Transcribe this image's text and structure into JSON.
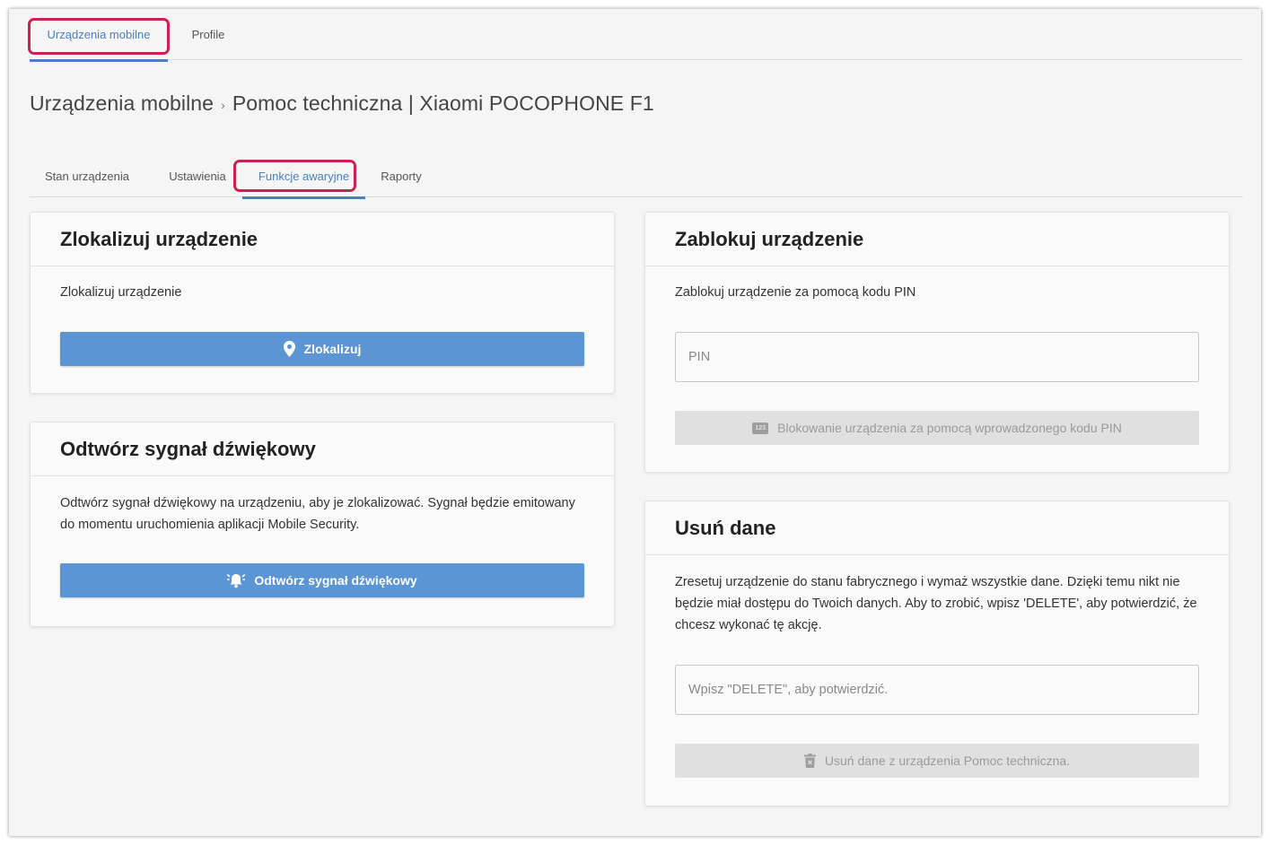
{
  "top_tabs": [
    {
      "label": "Urządzenia mobilne",
      "active": true
    },
    {
      "label": "Profile",
      "active": false
    }
  ],
  "breadcrumb": {
    "root": "Urządzenia mobilne",
    "separator": "›",
    "current": "Pomoc techniczna | Xiaomi POCOPHONE F1"
  },
  "sub_tabs": [
    {
      "label": "Stan urządzenia",
      "active": false
    },
    {
      "label": "Ustawienia",
      "active": false
    },
    {
      "label": "Funkcje awaryjne",
      "active": true
    },
    {
      "label": "Raporty",
      "active": false
    }
  ],
  "locate": {
    "title": "Zlokalizuj urządzenie",
    "description": "Zlokalizuj urządzenie",
    "button_label": "Zlokalizuj",
    "button_icon": "map-pin-icon"
  },
  "sound": {
    "title": "Odtwórz sygnał dźwiękowy",
    "description": "Odtwórz sygnał dźwiękowy na urządzeniu, aby je zlokalizować. Sygnał będzie emitowany do momentu uruchomienia aplikacji Mobile Security.",
    "button_label": "Odtwórz sygnał dźwiękowy",
    "button_icon": "alarm-bell-icon"
  },
  "lock": {
    "title": "Zablokuj urządzenie",
    "description": "Zablokuj urządzenie za pomocą kodu PIN",
    "pin_placeholder": "PIN",
    "pin_value": "",
    "button_label": "Blokowanie urządzenia za pomocą wprowadzonego kodu PIN",
    "button_icon": "keypad-icon",
    "keypad_icon_text": "123"
  },
  "wipe": {
    "title": "Usuń dane",
    "description": "Zresetuj urządzenie do stanu fabrycznego i wymaż wszystkie dane. Dzięki temu nikt nie będzie miał dostępu do Twoich danych. Aby to zrobić, wpisz 'DELETE', aby potwierdzić, że chcesz wykonać tę akcję.",
    "confirm_placeholder": "Wpisz \"DELETE\", aby potwierdzić.",
    "confirm_value": "",
    "button_label": "Usuń dane z urządzenia Pomoc techniczna.",
    "button_icon": "trash-icon"
  },
  "colors": {
    "accent": "#4a7fc1",
    "primary_button": "#5b95d4",
    "highlight": "#c8244f",
    "disabled_button": "#e0e0e0"
  }
}
